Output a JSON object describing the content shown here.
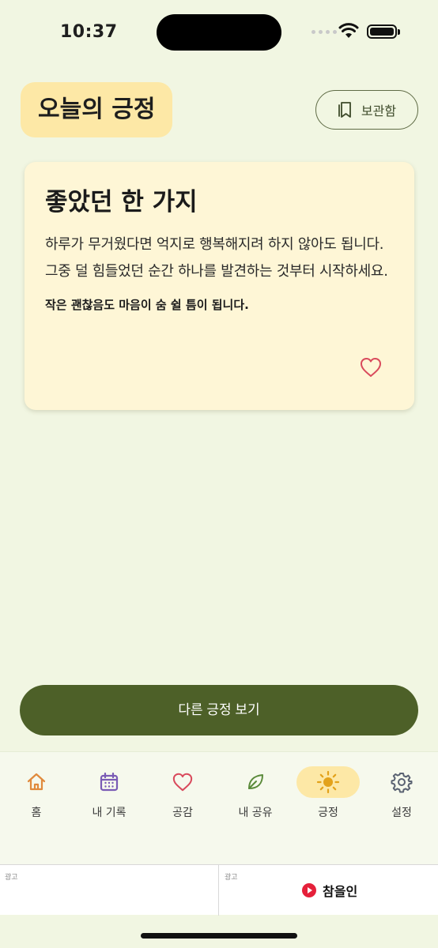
{
  "status_bar": {
    "time": "10:37"
  },
  "header": {
    "title": "오늘의 긍정",
    "archive_label": "보관함"
  },
  "card": {
    "title": "좋았던 한 가지",
    "body": "하루가 무거웠다면 억지로 행복해지려 하지 않아도 됩니다. 그중 덜 힘들었던 순간 하나를 발견하는 것부터 시작하세요.",
    "emphasis": "작은 괜찮음도 마음이 숨 쉴 틈이 됩니다."
  },
  "cta": {
    "label": "다른 긍정 보기"
  },
  "tabs": [
    {
      "label": "홈",
      "icon": "home-icon"
    },
    {
      "label": "내 기록",
      "icon": "calendar-icon"
    },
    {
      "label": "공감",
      "icon": "heart-icon"
    },
    {
      "label": "내 공유",
      "icon": "leaf-icon"
    },
    {
      "label": "긍정",
      "icon": "sun-icon",
      "active": true
    },
    {
      "label": "설정",
      "icon": "gear-icon"
    }
  ],
  "ads": {
    "left_tag": "광고",
    "right_tag": "광고",
    "brand": "참을인"
  },
  "colors": {
    "background": "#f1f6e2",
    "accent_yellow": "#fde8a6",
    "primary_green": "#4d6028",
    "heart_red": "#d94a5c"
  }
}
